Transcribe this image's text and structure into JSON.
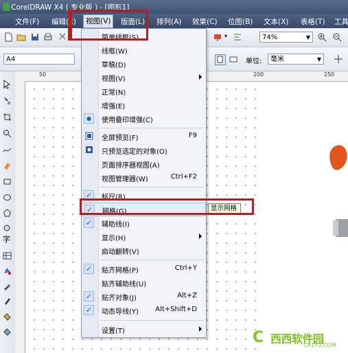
{
  "window": {
    "title": "CorelDRAW X4 ( 专业版 ) - [图形1]"
  },
  "menubar": [
    {
      "label": "文件(F)"
    },
    {
      "label": "编辑(E)"
    },
    {
      "label": "视图(V)"
    },
    {
      "label": "版面(L)"
    },
    {
      "label": "排列(A)"
    },
    {
      "label": "效果(C)"
    },
    {
      "label": "位图(B)"
    },
    {
      "label": "文本(X)"
    },
    {
      "label": "表格(T)"
    },
    {
      "label": "工具"
    }
  ],
  "toolbar": {
    "zoom": "74%",
    "page_size": "A4",
    "unit_label": "单位:",
    "unit_value": "毫米"
  },
  "rulers": {
    "top": [
      "50",
      "200",
      "250"
    ]
  },
  "view_menu": [
    {
      "label": "简单线框(S)",
      "shortcut": "",
      "check": false
    },
    {
      "label": "线框(W)",
      "shortcut": "",
      "check": false
    },
    {
      "label": "草稿(D)",
      "shortcut": "",
      "check": false
    },
    {
      "label": "视图(V)",
      "shortcut": "",
      "check": false,
      "submenu": true
    },
    {
      "label": "正常(N)",
      "shortcut": "",
      "check": false
    },
    {
      "label": "增强(E)",
      "shortcut": "",
      "check": false
    },
    {
      "label": "使用叠印增强(C)",
      "shortcut": "",
      "check": false,
      "bullet": true
    },
    {
      "label": "全屏预览(F)",
      "shortcut": "F9",
      "check": false,
      "icon": "fullscreen-preview-icon"
    },
    {
      "label": "只预览选定的对象(O)",
      "shortcut": "",
      "check": false,
      "icon": "preview-selected-icon"
    },
    {
      "label": "页面排序器视图(A)",
      "shortcut": "",
      "check": false
    },
    {
      "label": "视图管理器(W)",
      "shortcut": "Ctrl+F2",
      "check": false
    },
    {
      "label": "标尺(R)",
      "shortcut": "",
      "check": true
    },
    {
      "label": "网格(G)",
      "shortcut": "",
      "check": true
    },
    {
      "label": "辅助线(I)",
      "shortcut": "",
      "check": true
    },
    {
      "label": "显示(H)",
      "shortcut": "",
      "check": false,
      "submenu": true
    },
    {
      "label": "启动翻转(V)",
      "shortcut": "",
      "check": false
    },
    {
      "label": "贴齐网格(P)",
      "shortcut": "Ctrl+Y",
      "check": true
    },
    {
      "label": "贴齐辅助线(U)",
      "shortcut": "",
      "check": false
    },
    {
      "label": "贴齐对象(J)",
      "shortcut": "Alt+Z",
      "check": true
    },
    {
      "label": "动态导线(Y)",
      "shortcut": "Alt+Shift+D",
      "check": true
    },
    {
      "label": "设置(T)",
      "shortcut": "",
      "check": false,
      "submenu": true
    }
  ],
  "tooltip": "显示网格",
  "watermark": {
    "name": "西西软件园",
    "url": "CR173.COM"
  },
  "colors": {
    "accent": "#b41e1e",
    "title_bar": "#4e6283",
    "menu_bg": "#f2f4f8"
  }
}
